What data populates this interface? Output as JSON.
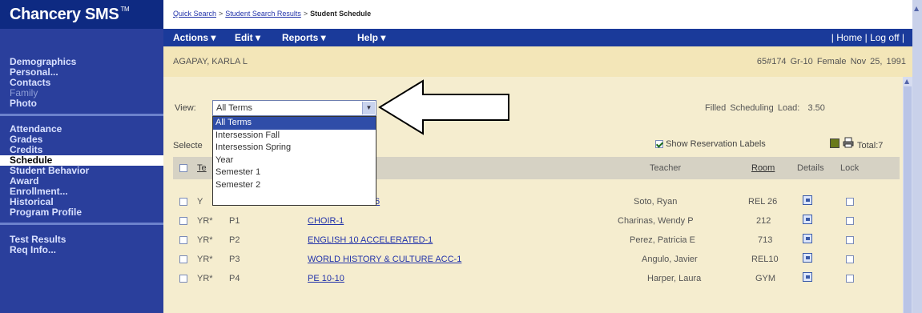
{
  "app": {
    "title": "Chancery SMS",
    "trademark": "TM"
  },
  "breadcrumb": {
    "items": [
      "Quick Search",
      "Student Search Results"
    ],
    "separator": ">",
    "current": "Student Schedule"
  },
  "menu": {
    "actions": "Actions ▾",
    "edit": "Edit ▾",
    "reports": "Reports ▾",
    "help": "Help ▾",
    "home": "Home",
    "logoff": "Log off"
  },
  "sidebar": {
    "group1": [
      "Demographics",
      "Personal...",
      "Contacts",
      "Family",
      "Photo"
    ],
    "group2": [
      "Attendance",
      "Grades",
      "Credits",
      "Schedule",
      "Student Behavior",
      "Award",
      "Enrollment...",
      "Historical",
      "Program Profile"
    ],
    "group3": [
      "Test Results",
      "Req Info..."
    ],
    "disabled": "Family",
    "active": "Schedule"
  },
  "student": {
    "name": "AGAPAY, KARLA L",
    "id": "65#174",
    "grade": "Gr-10",
    "gender": "Female",
    "dob": "Nov 25, 1991"
  },
  "view": {
    "label": "View:",
    "selected": "All Terms",
    "options": [
      "All Terms",
      "Intersession Fall",
      "Intersession Spring",
      "Year",
      "Semester 1",
      "Semester 2"
    ]
  },
  "filled": {
    "label": "Filled Scheduling Load:",
    "value": "3.50"
  },
  "selected_label": "Selecte",
  "reservation": {
    "label": "Show Reservation Labels",
    "checked": true
  },
  "total": "Total:7",
  "table": {
    "headers": {
      "term": "Te",
      "teacher": "Teacher",
      "room": "Room",
      "details": "Details",
      "lock": "Lock"
    },
    "rows": [
      {
        "term": "Y",
        "period": "",
        "course": "10-26",
        "teacher": "Soto, Ryan",
        "room": "REL 26"
      },
      {
        "term": "YR*",
        "period": "P1",
        "course": "CHOIR-1",
        "teacher": "Charinas, Wendy P",
        "room": "212"
      },
      {
        "term": "YR*",
        "period": "P2",
        "course": "ENGLISH 10 ACCELERATED-1",
        "teacher": "Perez, Patricia E",
        "room": "713"
      },
      {
        "term": "YR*",
        "period": "P3",
        "course": "WORLD HISTORY & CULTURE ACC-1",
        "teacher": "Angulo, Javier",
        "room": "REL10"
      },
      {
        "term": "YR*",
        "period": "P4",
        "course": "PE 10-10",
        "teacher": "Harper, Laura",
        "room": "GYM"
      }
    ]
  },
  "colors": {
    "nav_bg": "#2a3f9c",
    "banner_bg": "#f3e6b8",
    "panel_bg": "#f5edcf",
    "selected_option": "#2f4da8"
  }
}
